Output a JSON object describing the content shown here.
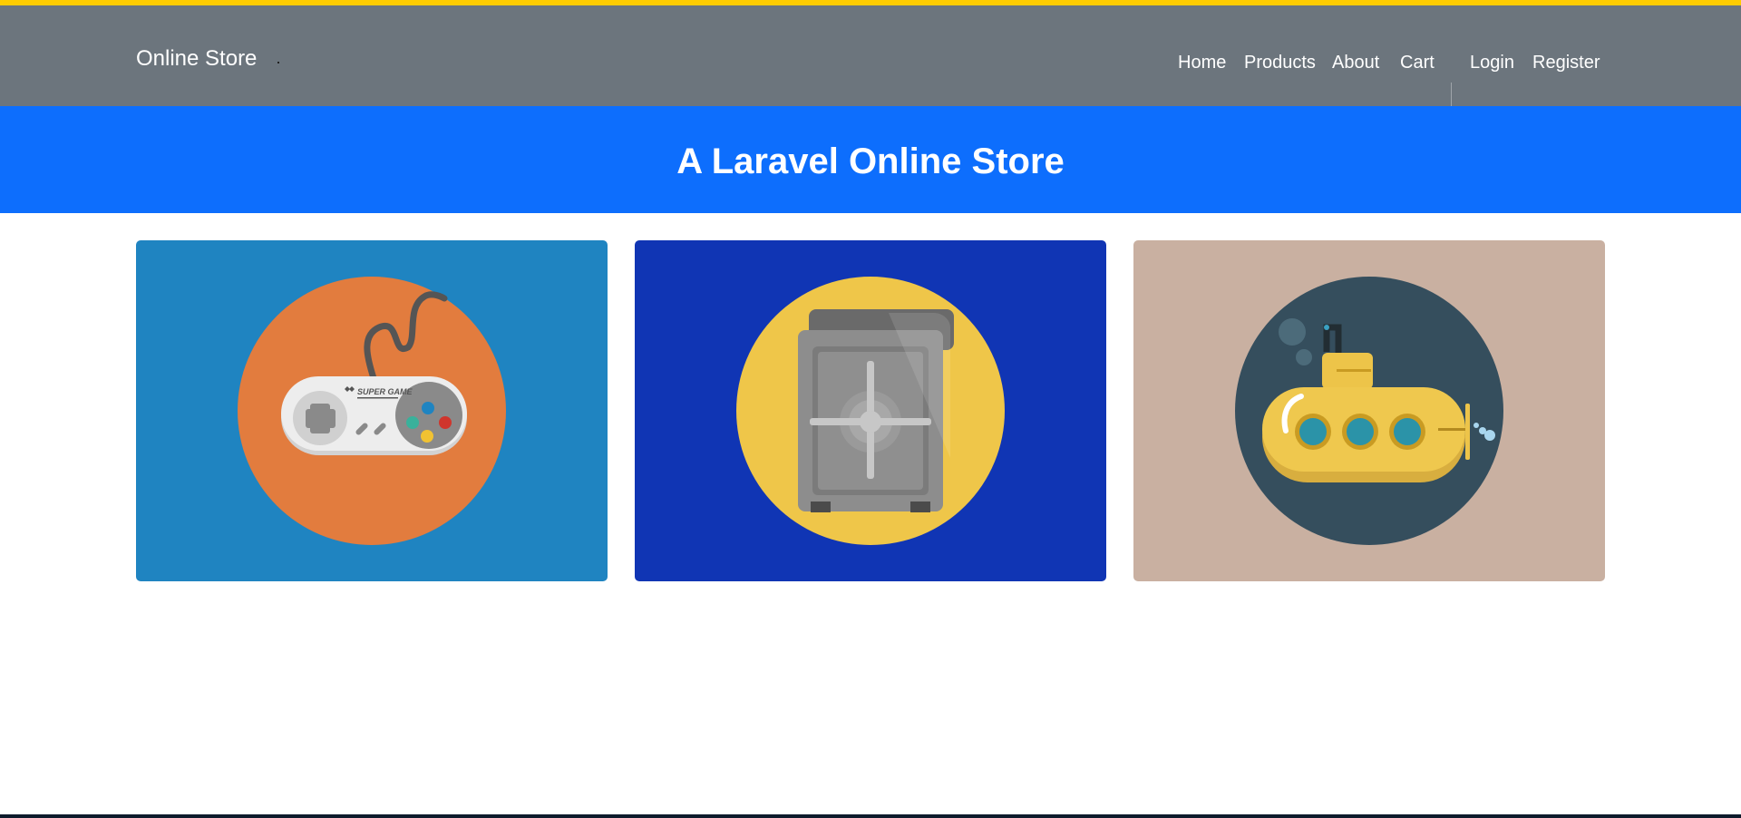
{
  "navbar": {
    "brand": "Online Store",
    "links": [
      {
        "label": "Home"
      },
      {
        "label": "Products"
      },
      {
        "label": "About"
      },
      {
        "label": "Cart"
      }
    ],
    "auth": [
      {
        "label": "Login"
      },
      {
        "label": "Register"
      }
    ]
  },
  "hero": {
    "title": "A Laravel Online Store"
  },
  "products": [
    {
      "icon": "game-controller-icon",
      "background": "#1f84c1",
      "circle": "#e27c3e",
      "print": "SUPER GAME"
    },
    {
      "icon": "safe-icon",
      "background": "#1035b4",
      "circle": "#efc649"
    },
    {
      "icon": "submarine-icon",
      "background": "#c9b0a1",
      "circle": "#354e5d"
    }
  ],
  "colors": {
    "accent": "#ffcc00",
    "navbar": "#6c757d",
    "hero": "#0d6efd"
  }
}
